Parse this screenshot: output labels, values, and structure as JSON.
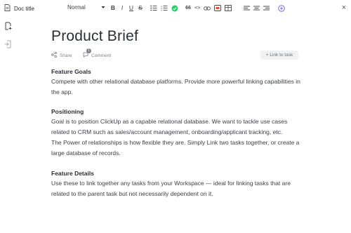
{
  "header": {
    "doc_title": "Doc title",
    "text_style": "Normal",
    "close_label": "×"
  },
  "toolbar": {
    "bold": "B",
    "italic": "I",
    "underline": "U",
    "strike": "S",
    "quote": "66",
    "code": "<>"
  },
  "doc": {
    "title": "Product Brief",
    "share_label": "Share",
    "comment_label": "Comment",
    "comment_count": "1",
    "link_task_label": "+ Link to task",
    "sections": [
      {
        "heading": "Feature Goals",
        "paragraphs": [
          "Compete with other relational database platforms. Provide more powerful linking capabilities in the app."
        ]
      },
      {
        "heading": "Positioning",
        "paragraphs": [
          "Goal is to position ClickUp as a capable relational database. We want to tackle use cases related to CRM such as sales/account management, onboarding/applicant tracking, etc.",
          "The Power of relationships is how flexible they are. Simply Link two tasks together, or create a large database of records."
        ]
      },
      {
        "heading": "Feature Details",
        "paragraphs": [
          "Use these to link together any tasks from your Workspace — ideal for linking tasks that are related to the parent task but not necessarily dependent on it."
        ]
      }
    ]
  },
  "colors": {
    "accent_green": "#2ecc71",
    "accent_purple": "#7b68ee",
    "accent_red": "#e74c3c"
  }
}
